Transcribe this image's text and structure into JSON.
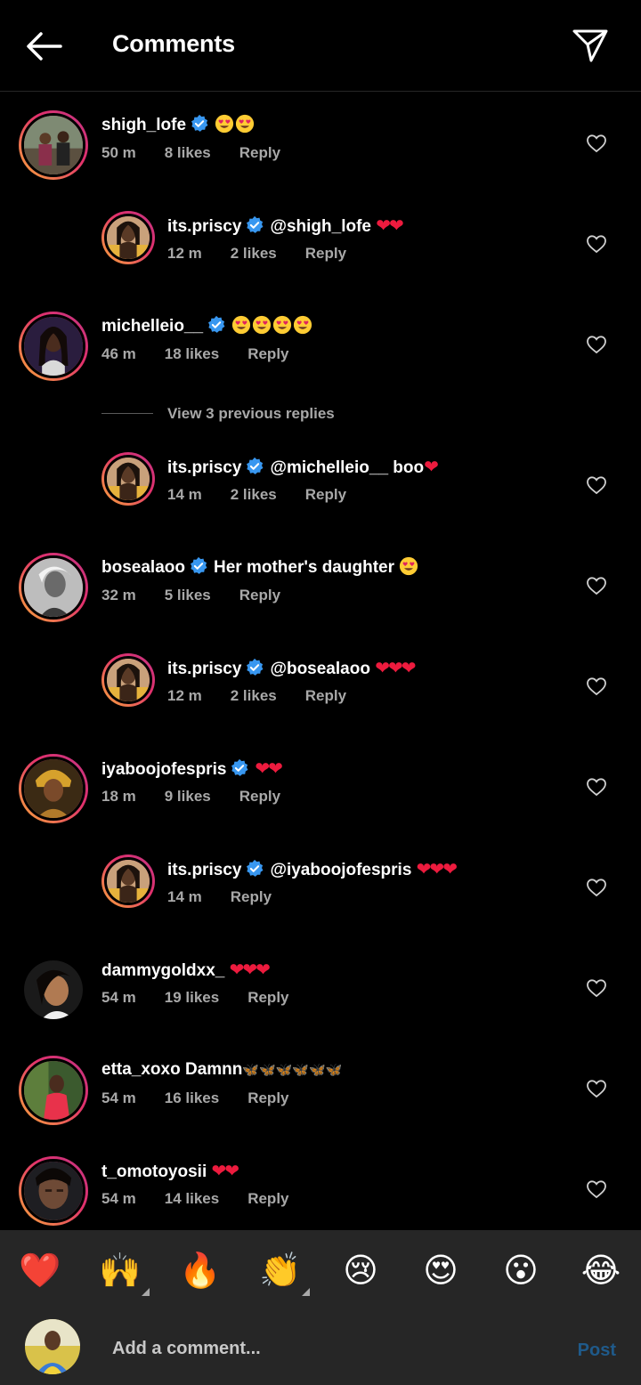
{
  "header": {
    "title": "Comments"
  },
  "comments": [
    {
      "user": "shigh_lofe",
      "verified": true,
      "text": "",
      "emojis": "smiley2",
      "time": "50 m",
      "likes": "8 likes",
      "reply": "Reply"
    },
    {
      "user": "its.priscy",
      "verified": true,
      "text": "@shigh_lofe",
      "hearts": "❤❤",
      "time": "12 m",
      "likes": "2 likes",
      "reply": "Reply"
    },
    {
      "user": "michelleio__",
      "verified": true,
      "text": "",
      "emojis": "smiley4",
      "time": "46 m",
      "likes": "18 likes",
      "reply": "Reply"
    },
    {
      "user": "its.priscy",
      "verified": true,
      "text": "@michelleio__ boo",
      "hearts": "❤",
      "time": "14 m",
      "likes": "2 likes",
      "reply": "Reply"
    },
    {
      "user": "bosealaoo",
      "verified": true,
      "text": "Her mother's daughter",
      "emojis": "smiley1",
      "time": "32 m",
      "likes": "5 likes",
      "reply": "Reply"
    },
    {
      "user": "its.priscy",
      "verified": true,
      "text": "@bosealaoo",
      "hearts": "❤❤❤",
      "time": "12 m",
      "likes": "2 likes",
      "reply": "Reply"
    },
    {
      "user": "iyaboojofespris",
      "verified": true,
      "text": "",
      "hearts": "❤❤",
      "time": "18 m",
      "likes": "9 likes",
      "reply": "Reply"
    },
    {
      "user": "its.priscy",
      "verified": true,
      "text": "@iyaboojofespris",
      "hearts": "❤❤❤",
      "time": "14 m",
      "likes": "",
      "reply": "Reply"
    },
    {
      "user": "dammygoldxx_",
      "verified": false,
      "text": "",
      "hearts": "❤❤❤",
      "time": "54 m",
      "likes": "19 likes",
      "reply": "Reply"
    },
    {
      "user": "etta_xoxo",
      "verified": false,
      "text": "Damnn",
      "butterflies": "🦋🦋🦋🦋🦋🦋",
      "time": "54 m",
      "likes": "16 likes",
      "reply": "Reply"
    },
    {
      "user": "t_omotoyosii",
      "verified": false,
      "text": "",
      "hearts": "❤❤",
      "time": "54 m",
      "likes": "14 likes",
      "reply": "Reply"
    }
  ],
  "view_replies": "View 3 previous replies",
  "emoji_bar": [
    "❤️",
    "🙌",
    "🔥",
    "👏",
    "😢",
    "😍",
    "😮",
    "😂"
  ],
  "composer": {
    "placeholder": "Add a comment...",
    "post": "Post"
  }
}
